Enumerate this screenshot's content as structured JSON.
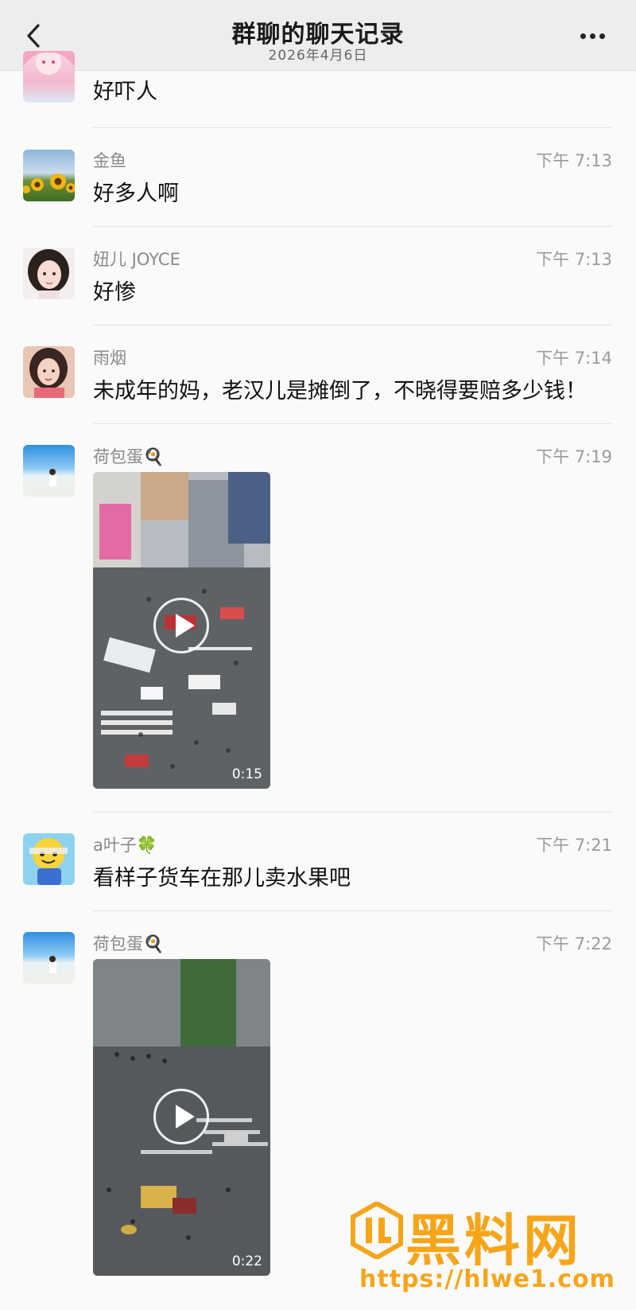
{
  "header": {
    "title": "群聊的聊天记录",
    "date": "2026年4月6日"
  },
  "messages": [
    {
      "name": "",
      "time": "",
      "text": "好吓人"
    },
    {
      "name": "金鱼",
      "time": "下午 7:13",
      "text": "好多人啊"
    },
    {
      "name": "妞儿 JOYCE",
      "time": "下午 7:13",
      "text": "好惨"
    },
    {
      "name": "雨烟",
      "time": "下午 7:14",
      "text": "未成年的妈，老汉儿是摊倒了，不晓得要赔多少钱！"
    },
    {
      "name": "荷包蛋🍳",
      "time": "下午 7:19",
      "video_duration": "0:15"
    },
    {
      "name": "a叶子🍀",
      "time": "下午 7:21",
      "text": "看样子货车在那儿卖水果吧"
    },
    {
      "name": "荷包蛋🍳",
      "time": "下午 7:22",
      "video_duration": "0:22"
    }
  ],
  "watermark": {
    "text": "黑料网",
    "url": "https://hlwe1.com"
  },
  "colors": {
    "header_bg": "#ededed",
    "page_bg": "#fafafa",
    "watermark": "#f6a51a"
  },
  "icons": [
    "back-chevron-icon",
    "more-dots-icon",
    "play-icon"
  ]
}
